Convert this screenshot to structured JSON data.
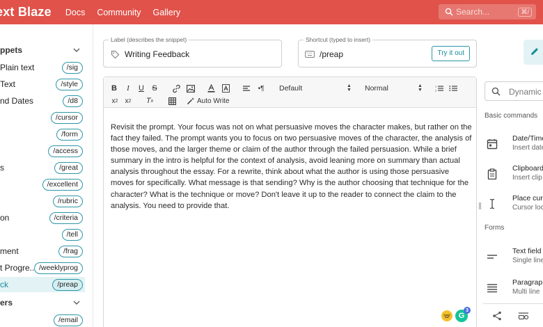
{
  "header": {
    "brand": "ext Blaze",
    "nav": [
      "Docs",
      "Community",
      "Gallery"
    ],
    "search_placeholder": "Search...",
    "search_shortcut": "⌘/"
  },
  "sidebar": {
    "folder_1": "ppets",
    "folder_2": "ers",
    "snippets": [
      {
        "name": "Plain text",
        "shortcut": "/sig"
      },
      {
        "name": "Text",
        "shortcut": "/style"
      },
      {
        "name": "nd Dates",
        "shortcut": "/d8"
      },
      {
        "name": "",
        "shortcut": "/cursor"
      },
      {
        "name": "",
        "shortcut": "/form"
      },
      {
        "name": "",
        "shortcut": "/access"
      },
      {
        "name": "s",
        "shortcut": "/great"
      },
      {
        "name": "",
        "shortcut": "/excellent"
      },
      {
        "name": "",
        "shortcut": "/rubric"
      },
      {
        "name": "on",
        "shortcut": "/criteria"
      },
      {
        "name": "",
        "shortcut": "/tell"
      },
      {
        "name": "ment",
        "shortcut": "/frag"
      },
      {
        "name": "t Progre...",
        "shortcut": "/weeklyprog"
      },
      {
        "name": "ck",
        "shortcut": "/preap"
      }
    ],
    "folder2_snippets": [
      {
        "name": "",
        "shortcut": "/email"
      }
    ]
  },
  "label_field": {
    "label": "Label (describes the snippet)",
    "value": "Writing Feedback"
  },
  "shortcut_field": {
    "label": "Shortcut (typed to insert)",
    "value": "/preap",
    "try_label": "Try it out"
  },
  "toolbar": {
    "font_select": "Default",
    "size_select": "Normal",
    "auto_write": "Auto Write"
  },
  "editor": {
    "content": "Revisit the prompt. Your focus was not on what persuasive moves the character makes, but rather on the fact they failed. The prompt wants you to focus on two persuasive moves of the character, the analysis of those moves, and the larger theme or claim of the author through the failed persuasion. While a brief summary in the intro is helpful for the context of analysis, avoid leaning more on summary than actual analysis throughout the essay. For a rewrite, think about what the author is using those persuasive moves for specifically. What message is that sending? Why is the author choosing that technique for the character? What is the technique or move? Don't leave it up to the reader to connect the claim to the analysis. You need to provide that.",
    "grammarly_count": "3"
  },
  "right_panel": {
    "search_placeholder": "Dynamic c",
    "section_basic": "Basic commands",
    "section_forms": "Forms",
    "commands": [
      {
        "title": "Date/Time",
        "sub": "Insert date",
        "icon": "calendar-icon"
      },
      {
        "title": "Clipboard",
        "sub": "Insert clip",
        "icon": "clipboard-icon"
      },
      {
        "title": "Place curs",
        "sub": "Cursor loc",
        "icon": "text-cursor-icon"
      }
    ],
    "forms": [
      {
        "title": "Text field",
        "sub": "Single line",
        "icon": "text-field-icon"
      },
      {
        "title": "Paragraph",
        "sub": "Multi line",
        "icon": "paragraph-icon"
      }
    ]
  },
  "colors": {
    "header": "#e0524a",
    "accent": "#2a96a6",
    "active_bg": "#e3f3f5"
  }
}
